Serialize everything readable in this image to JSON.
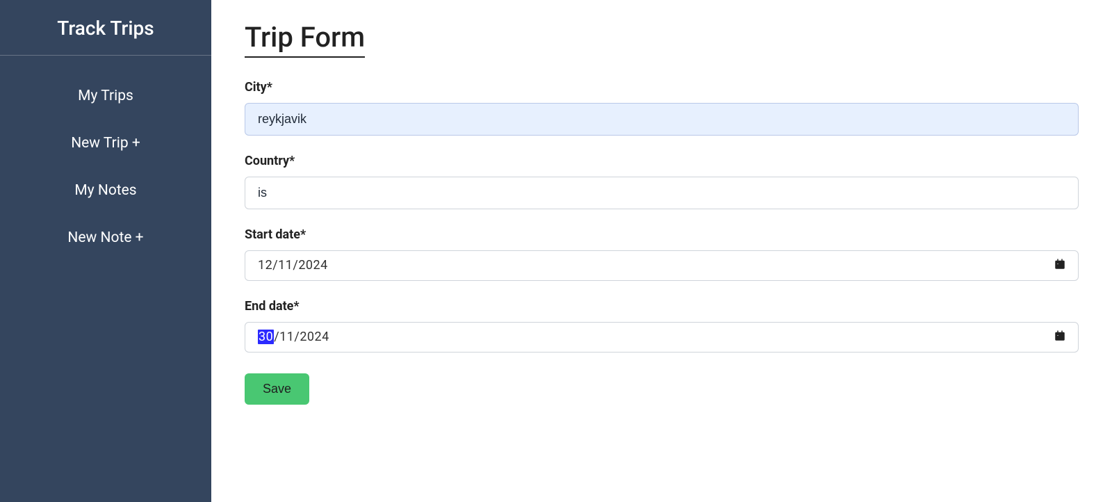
{
  "sidebar": {
    "brand": "Track Trips",
    "items": [
      {
        "label": "My Trips"
      },
      {
        "label": "New Trip +"
      },
      {
        "label": "My Notes"
      },
      {
        "label": "New Note +"
      }
    ]
  },
  "main": {
    "title": "Trip Form",
    "fields": {
      "city": {
        "label": "City*",
        "value": "reykjavik"
      },
      "country": {
        "label": "Country*",
        "value": "is"
      },
      "start": {
        "label": "Start date*",
        "value": "12/11/2024"
      },
      "end": {
        "label": "End date*",
        "day_hl": "30",
        "rest": "/11/2024"
      }
    },
    "save_label": "Save"
  }
}
